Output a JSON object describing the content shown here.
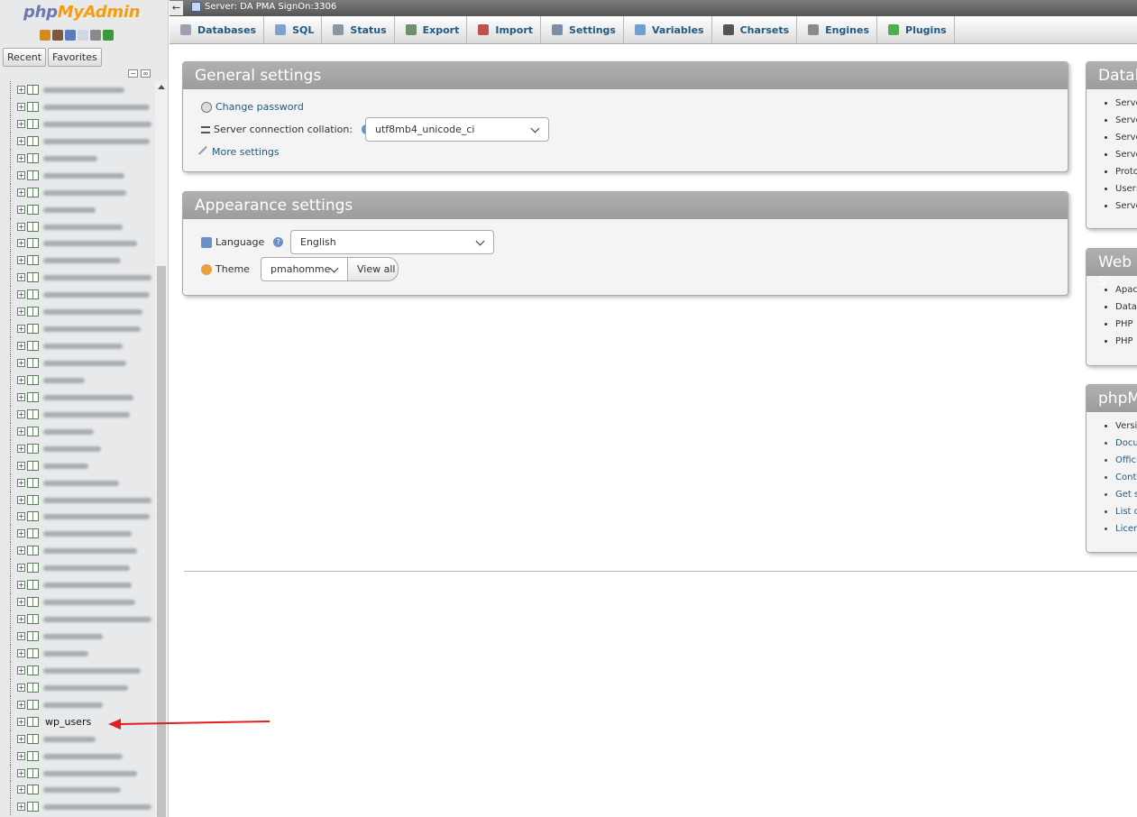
{
  "logo": {
    "php": "php",
    "myadmin": "MyAdmin"
  },
  "nav": {
    "icons": [
      {
        "name": "home-icon",
        "color": "#d48a1e"
      },
      {
        "name": "logout-icon",
        "color": "#7a5a3a"
      },
      {
        "name": "help-icon",
        "color": "#5a7dbf"
      },
      {
        "name": "docs-icon",
        "color": "#cfd8e6"
      },
      {
        "name": "settings-gear-icon",
        "color": "#8a8a8a"
      },
      {
        "name": "reload-icon",
        "color": "#3a9a3a"
      }
    ],
    "tabs": {
      "recent": "Recent",
      "favorites": "Favorites"
    },
    "highlighted_table": "wp_users",
    "blurred_rows_before": 37,
    "blurred_rows_after": 5
  },
  "topbar": {
    "back": "←",
    "server": "Server: DA PMA SignOn:3306"
  },
  "menu": [
    {
      "key": "databases",
      "label": "Databases",
      "icon": "databases-icon",
      "color": "#9aa3ad"
    },
    {
      "key": "sql",
      "label": "SQL",
      "icon": "sql-icon",
      "color": "#7fa2d1"
    },
    {
      "key": "status",
      "label": "Status",
      "icon": "status-icon",
      "color": "#8a96a3"
    },
    {
      "key": "export",
      "label": "Export",
      "icon": "export-icon",
      "color": "#6f8f6f"
    },
    {
      "key": "import",
      "label": "Import",
      "icon": "import-icon",
      "color": "#c0504d"
    },
    {
      "key": "settings",
      "label": "Settings",
      "icon": "wrench-icon",
      "color": "#7c8ea3"
    },
    {
      "key": "variables",
      "label": "Variables",
      "icon": "variables-icon",
      "color": "#6f9fcf"
    },
    {
      "key": "charsets",
      "label": "Charsets",
      "icon": "charsets-icon",
      "color": "#555555"
    },
    {
      "key": "engines",
      "label": "Engines",
      "icon": "engines-icon",
      "color": "#8a8a8a"
    },
    {
      "key": "plugins",
      "label": "Plugins",
      "icon": "plugins-icon",
      "color": "#4caf50"
    }
  ],
  "general": {
    "title": "General settings",
    "change_password": "Change password",
    "collation_label": "Server connection collation:",
    "collation_value": "utf8mb4_unicode_ci",
    "more_settings": "More settings"
  },
  "appearance": {
    "title": "Appearance settings",
    "language_label": "Language",
    "language_value": "English",
    "theme_label": "Theme",
    "theme_value": "pmahomme",
    "view_all": "View all"
  },
  "database_server": {
    "title": "Datab",
    "items": [
      "Serve",
      "Serve",
      "Serve",
      "Serve",
      "Proto",
      "User:",
      "Serve"
    ]
  },
  "web_server": {
    "title": "Web s",
    "items": [
      "Apac",
      "Datal",
      "PHP",
      "PHP"
    ]
  },
  "phpmyadmin_info": {
    "title": "phpM",
    "items": [
      "Versi",
      "Docu",
      "Offici",
      "Contr",
      "Get s",
      "List o",
      "Licen"
    ]
  },
  "colors": {
    "link": "#235a81",
    "accent_orange": "#f89c0e",
    "logo_blue": "#6c78af",
    "arrow_red": "#e02020"
  }
}
